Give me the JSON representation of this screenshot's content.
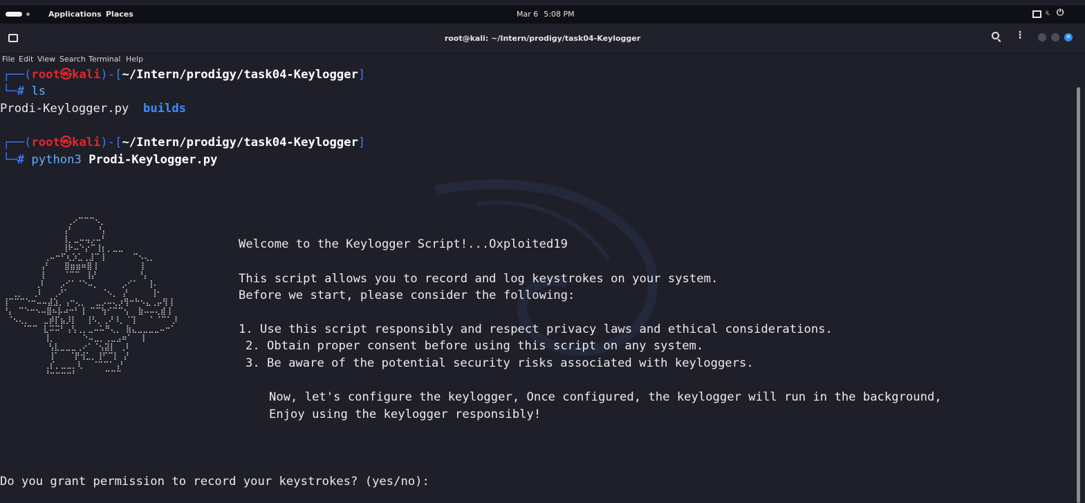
{
  "top_panel": {
    "applications": "Applications",
    "places": "Places",
    "date": "Mar 6",
    "time": "5:08 PM"
  },
  "window": {
    "title": "root@kali: ~/Intern/prodigy/task04-Keylogger"
  },
  "menu": [
    "File",
    "Edit",
    "View",
    "Search",
    "Terminal",
    "Help"
  ],
  "terminal": {
    "prompt1": {
      "open": "┌──(",
      "user": "root㉿kali",
      "mid": ")-[",
      "path": "~/Intern/prodigy/task04-Keylogger",
      "close": "]",
      "hash_prefix": "└─",
      "hash": "#",
      "command": " ls"
    },
    "ls_output": {
      "file": "Prodi-Keylogger.py",
      "dir": "builds"
    },
    "prompt2": {
      "open": "┌──(",
      "user": "root㉿kali",
      "mid": ")-[",
      "path": "~/Intern/prodigy/task04-Keylogger",
      "close": "]",
      "hash_prefix": "└─",
      "hash": "#",
      "command": " python3 ",
      "arg": "Prodi-Keylogger.py"
    },
    "banner": {
      "welcome": "Welcome to the Keylogger Script!...Oxploited19",
      "line1": "This script allows you to record and log keystrokes on your system.",
      "line2": "Before we start, please consider the following:",
      "item1": "1. Use this script responsibly and respect privacy laws and ethical considerations.",
      "item2": "2. Obtain proper consent before using this script on any system.",
      "item3": "3. Be aware of the potential security risks associated with keyloggers.",
      "note1": "Now, let's configure the keylogger, Once configured, the keylogger will run in the background,",
      "note2": "Enjoy using the keylogger responsibly!"
    },
    "question": "Do you grant permission to record your keystrokes? (yes/no):"
  }
}
